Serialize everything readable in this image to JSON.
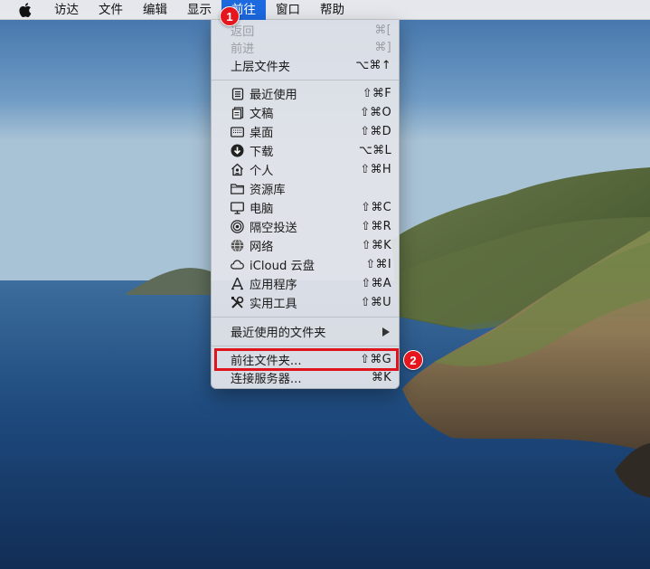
{
  "menubar": {
    "items": [
      {
        "label": "访达"
      },
      {
        "label": "文件"
      },
      {
        "label": "编辑"
      },
      {
        "label": "显示"
      },
      {
        "label": "前往",
        "active": true
      },
      {
        "label": "窗口"
      },
      {
        "label": "帮助"
      }
    ],
    "active_color": "#1d69e0"
  },
  "go_menu": {
    "sections": [
      {
        "items": [
          {
            "label": "返回",
            "shortcut": "⌘[",
            "enabled": false
          },
          {
            "label": "前进",
            "shortcut": "⌘]",
            "enabled": false
          },
          {
            "label": "上层文件夹",
            "shortcut": "⌥⌘↑",
            "enabled": true
          }
        ]
      },
      {
        "items": [
          {
            "label": "最近使用",
            "shortcut": "⇧⌘F",
            "icon": "recents-icon"
          },
          {
            "label": "文稿",
            "shortcut": "⇧⌘O",
            "icon": "documents-icon"
          },
          {
            "label": "桌面",
            "shortcut": "⇧⌘D",
            "icon": "desktop-icon"
          },
          {
            "label": "下载",
            "shortcut": "⌥⌘L",
            "icon": "downloads-icon"
          },
          {
            "label": "个人",
            "shortcut": "⇧⌘H",
            "icon": "home-icon"
          },
          {
            "label": "资源库",
            "shortcut": "",
            "icon": "library-folder-icon"
          },
          {
            "label": "电脑",
            "shortcut": "⇧⌘C",
            "icon": "computer-icon"
          },
          {
            "label": "隔空投送",
            "shortcut": "⇧⌘R",
            "icon": "airdrop-icon"
          },
          {
            "label": "网络",
            "shortcut": "⇧⌘K",
            "icon": "network-icon"
          },
          {
            "label": "iCloud 云盘",
            "shortcut": "⇧⌘I",
            "icon": "icloud-icon"
          },
          {
            "label": "应用程序",
            "shortcut": "⇧⌘A",
            "icon": "applications-icon"
          },
          {
            "label": "实用工具",
            "shortcut": "⇧⌘U",
            "icon": "utilities-icon"
          }
        ]
      },
      {
        "items": [
          {
            "label": "最近使用的文件夹",
            "submenu": true
          }
        ]
      },
      {
        "items": [
          {
            "label": "前往文件夹...",
            "shortcut": "⇧⌘G",
            "highlighted": true
          },
          {
            "label": "连接服务器...",
            "shortcut": "⌘K"
          }
        ]
      }
    ]
  },
  "annotations": {
    "badges": [
      "1",
      "2"
    ],
    "highlight_color": "#e0141c"
  }
}
